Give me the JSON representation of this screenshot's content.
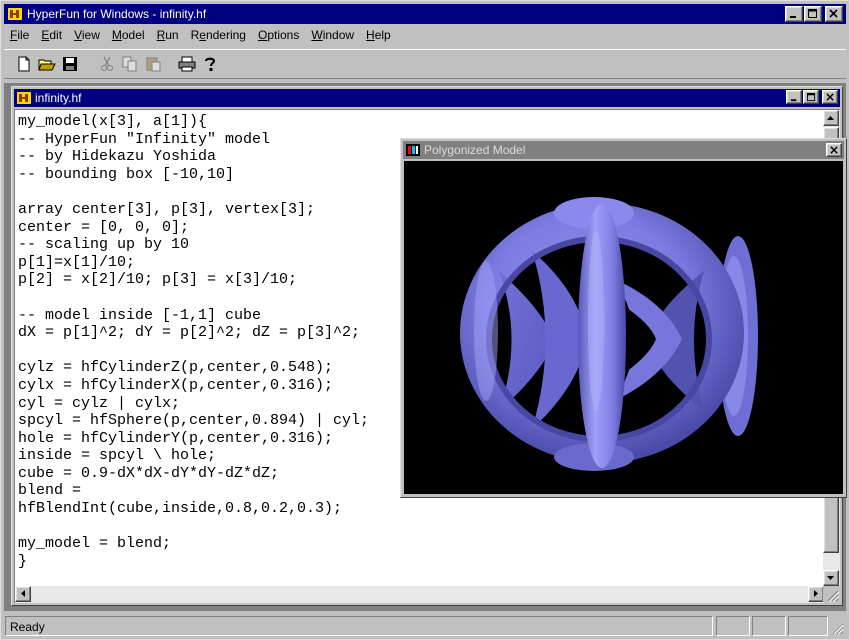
{
  "window": {
    "title": "HyperFun for Windows - infinity.hf"
  },
  "menu": [
    {
      "pre": "",
      "u": "F",
      "post": "ile"
    },
    {
      "pre": "",
      "u": "E",
      "post": "dit"
    },
    {
      "pre": "",
      "u": "V",
      "post": "iew"
    },
    {
      "pre": "",
      "u": "M",
      "post": "odel"
    },
    {
      "pre": "",
      "u": "R",
      "post": "un"
    },
    {
      "pre": "R",
      "u": "e",
      "post": "ndering"
    },
    {
      "pre": "",
      "u": "O",
      "post": "ptions"
    },
    {
      "pre": "",
      "u": "W",
      "post": "indow"
    },
    {
      "pre": "",
      "u": "H",
      "post": "elp"
    }
  ],
  "toolbar": {
    "buttons": [
      "new-file-icon",
      "open-folder-icon",
      "save-disk-icon",
      "cut-scissors-icon",
      "copy-icon",
      "paste-clipboard-icon",
      "print-icon",
      "help-question-icon"
    ]
  },
  "document": {
    "title": "infinity.hf",
    "code": "my_model(x[3], a[1]){\n-- HyperFun \"Infinity\" model\n-- by Hidekazu Yoshida\n-- bounding box [-10,10]\n\narray center[3], p[3], vertex[3];\ncenter = [0, 0, 0];\n-- scaling up by 10\np[1]=x[1]/10;\np[2] = x[2]/10; p[3] = x[3]/10;\n\n-- model inside [-1,1] cube\ndX = p[1]^2; dY = p[2]^2; dZ = p[3]^2;\n\ncylz = hfCylinderZ(p,center,0.548);\ncylx = hfCylinderX(p,center,0.316);\ncyl = cylz | cylx;\nspcyl = hfSphere(p,center,0.894) | cyl;\nhole = hfCylinderY(p,center,0.316);\ninside = spcyl \\ hole;\ncube = 0.9-dX*dX-dY*dY-dZ*dZ;\nblend =\nhfBlendInt(cube,inside,0.8,0.2,0.3);\n\nmy_model = blend;\n}"
  },
  "viewer": {
    "title": "Polygonized Model",
    "model_color": "#8080e6"
  },
  "status": {
    "text": "Ready"
  },
  "colors": {
    "titlebar_active": "#000080",
    "titlebar_inactive": "#808080",
    "face": "#c0c0c0"
  }
}
